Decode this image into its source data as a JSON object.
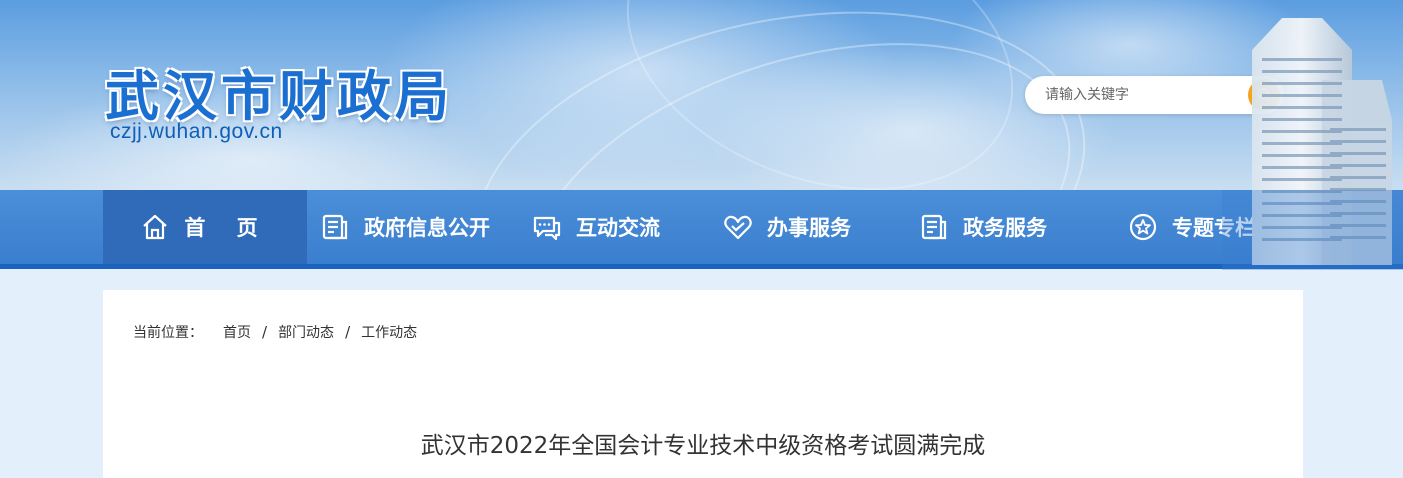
{
  "site": {
    "title": "武汉市财政局",
    "url": "czjj.wuhan.gov.cn"
  },
  "search": {
    "placeholder": "请输入关键字",
    "button_icon": "search-icon",
    "accent": "#f5a21c"
  },
  "nav": {
    "items": [
      {
        "label": "首  页",
        "icon": "home-icon",
        "active": true
      },
      {
        "label": "政府信息公开",
        "icon": "document-icon",
        "active": false
      },
      {
        "label": "互动交流",
        "icon": "chat-icon",
        "active": false
      },
      {
        "label": "办事服务",
        "icon": "heart-icon",
        "active": false
      },
      {
        "label": "政务服务",
        "icon": "document-icon",
        "active": false
      },
      {
        "label": "专题专栏",
        "icon": "star-icon",
        "active": false
      }
    ]
  },
  "breadcrumb": {
    "prefix": "当前位置：",
    "items": [
      "首页",
      "部门动态",
      "工作动态"
    ],
    "separator": "/"
  },
  "article": {
    "title": "武汉市2022年全国会计专业技术中级资格考试圆满完成"
  },
  "colors": {
    "nav_bg": "#3a7fcf",
    "nav_active": "#2f6bb8",
    "brand_blue": "#1a6fd0"
  }
}
